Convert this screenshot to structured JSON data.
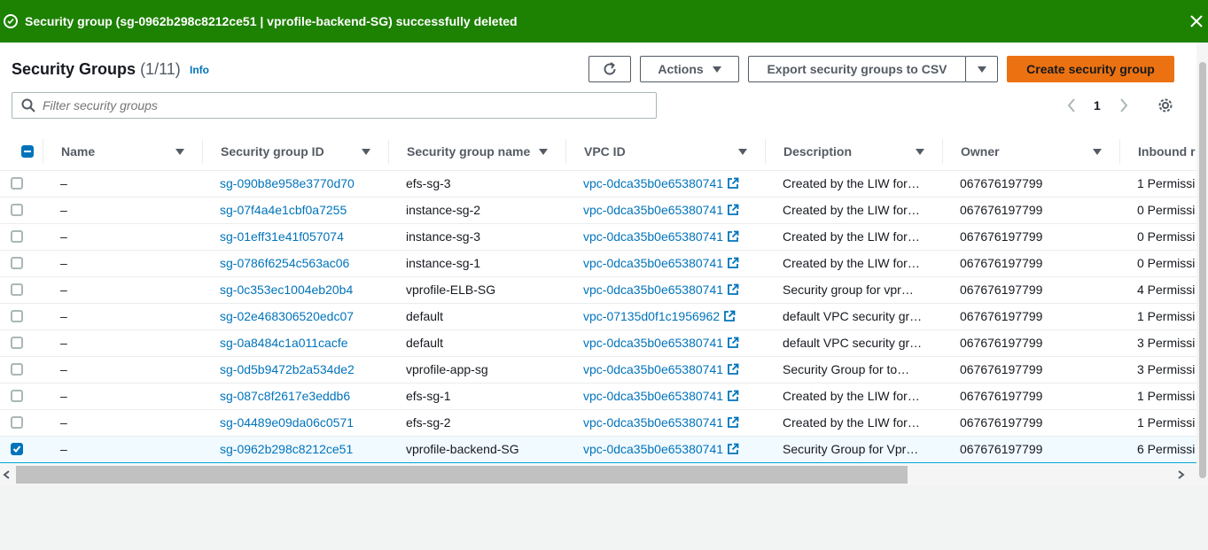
{
  "flash": {
    "message": "Security group (sg-0962b298c8212ce51 | vprofile-backend-SG) successfully deleted",
    "color": "#1d8102"
  },
  "header": {
    "title": "Security Groups",
    "count": "(1/11)",
    "info": "Info"
  },
  "toolbar": {
    "actions_label": "Actions",
    "export_label": "Export security groups to CSV",
    "create_label": "Create security group",
    "primary_color": "#ec7211"
  },
  "search": {
    "placeholder": "Filter security groups"
  },
  "pagination": {
    "page": "1"
  },
  "table": {
    "columns": [
      "Name",
      "Security group ID",
      "Security group name",
      "VPC ID",
      "Description",
      "Owner",
      "Inbound r"
    ],
    "rows": [
      {
        "name": "–",
        "id": "sg-090b8e958e3770d70",
        "sgname": "efs-sg-3",
        "vpc": "vpc-0dca35b0e65380741",
        "desc": "Created by the LIW for…",
        "owner": "067676197799",
        "inbound": "1 Permissi",
        "checked": false
      },
      {
        "name": "–",
        "id": "sg-07f4a4e1cbf0a7255",
        "sgname": "instance-sg-2",
        "vpc": "vpc-0dca35b0e65380741",
        "desc": "Created by the LIW for…",
        "owner": "067676197799",
        "inbound": "0 Permissi",
        "checked": false
      },
      {
        "name": "–",
        "id": "sg-01eff31e41f057074",
        "sgname": "instance-sg-3",
        "vpc": "vpc-0dca35b0e65380741",
        "desc": "Created by the LIW for…",
        "owner": "067676197799",
        "inbound": "0 Permissi",
        "checked": false
      },
      {
        "name": "–",
        "id": "sg-0786f6254c563ac06",
        "sgname": "instance-sg-1",
        "vpc": "vpc-0dca35b0e65380741",
        "desc": "Created by the LIW for…",
        "owner": "067676197799",
        "inbound": "0 Permissi",
        "checked": false
      },
      {
        "name": "–",
        "id": "sg-0c353ec1004eb20b4",
        "sgname": "vprofile-ELB-SG",
        "vpc": "vpc-0dca35b0e65380741",
        "desc": "Security group for vpr…",
        "owner": "067676197799",
        "inbound": "4 Permissi",
        "checked": false
      },
      {
        "name": "–",
        "id": "sg-02e468306520edc07",
        "sgname": "default",
        "vpc": "vpc-07135d0f1c1956962",
        "desc": "default VPC security gr…",
        "owner": "067676197799",
        "inbound": "1 Permissi",
        "checked": false
      },
      {
        "name": "–",
        "id": "sg-0a8484c1a011cacfe",
        "sgname": "default",
        "vpc": "vpc-0dca35b0e65380741",
        "desc": "default VPC security gr…",
        "owner": "067676197799",
        "inbound": "3 Permissi",
        "checked": false
      },
      {
        "name": "–",
        "id": "sg-0d5b9472b2a534de2",
        "sgname": "vprofile-app-sg",
        "vpc": "vpc-0dca35b0e65380741",
        "desc": "Security Group for to…",
        "owner": "067676197799",
        "inbound": "3 Permissi",
        "checked": false
      },
      {
        "name": "–",
        "id": "sg-087c8f2617e3eddb6",
        "sgname": "efs-sg-1",
        "vpc": "vpc-0dca35b0e65380741",
        "desc": "Created by the LIW for…",
        "owner": "067676197799",
        "inbound": "1 Permissi",
        "checked": false
      },
      {
        "name": "–",
        "id": "sg-04489e09da06c0571",
        "sgname": "efs-sg-2",
        "vpc": "vpc-0dca35b0e65380741",
        "desc": "Created by the LIW for…",
        "owner": "067676197799",
        "inbound": "1 Permissi",
        "checked": false
      },
      {
        "name": "–",
        "id": "sg-0962b298c8212ce51",
        "sgname": "vprofile-backend-SG",
        "vpc": "vpc-0dca35b0e65380741",
        "desc": "Security Group for Vpr…",
        "owner": "067676197799",
        "inbound": "6 Permissi",
        "checked": true
      }
    ]
  }
}
